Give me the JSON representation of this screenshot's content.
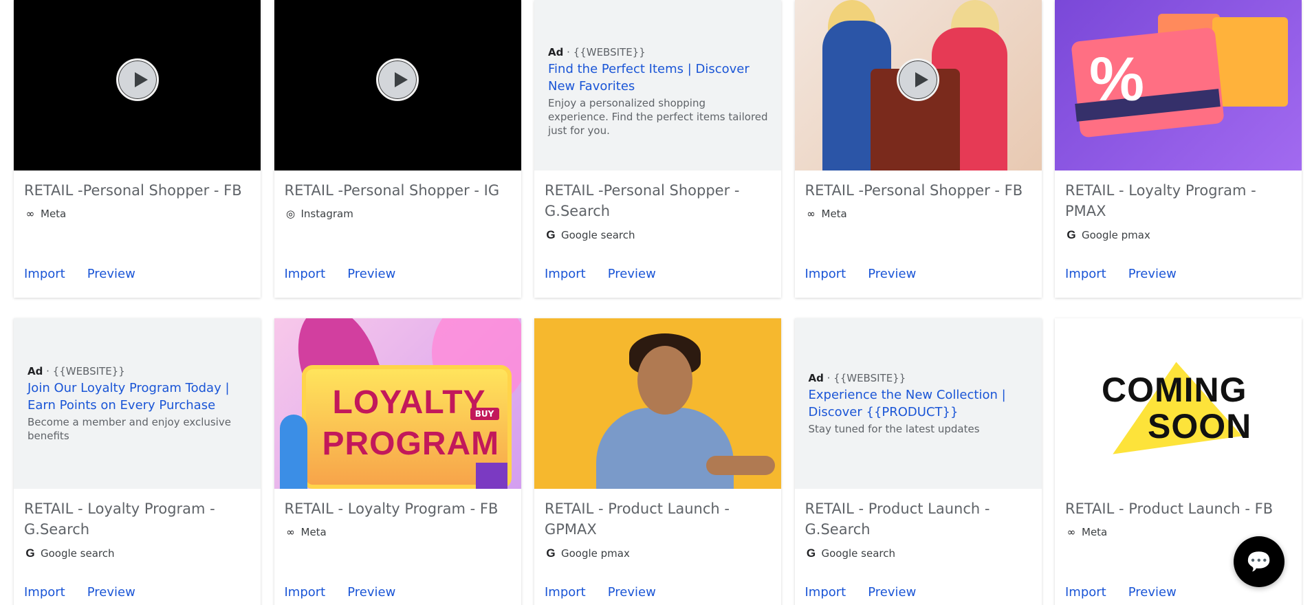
{
  "cards": [
    {
      "title": "RETAIL -Personal Shopper - FB",
      "platform": "Meta",
      "platform_icon": "meta-icon",
      "import": "Import",
      "preview": "Preview"
    },
    {
      "title": "RETAIL -Personal Shopper - IG",
      "platform": "Instagram",
      "platform_icon": "instagram-icon",
      "import": "Import",
      "preview": "Preview"
    },
    {
      "title": "RETAIL -Personal Shopper - G.Search",
      "platform": "Google search",
      "platform_icon": "google-icon",
      "import": "Import",
      "preview": "Preview",
      "ad": {
        "label": "Ad",
        "site": " · {{WEBSITE}}",
        "headline": "Find the Perfect Items | Discover New Favorites",
        "desc": "Enjoy a personalized shopping experience. Find the perfect items tailored just for you."
      }
    },
    {
      "title": "RETAIL -Personal Shopper - FB",
      "platform": "Meta",
      "platform_icon": "meta-icon",
      "import": "Import",
      "preview": "Preview"
    },
    {
      "title": "RETAIL - Loyalty Program - PMAX",
      "platform": "Google pmax",
      "platform_icon": "google-icon",
      "import": "Import",
      "preview": "Preview"
    },
    {
      "title": "RETAIL - Loyalty Program - G.Search",
      "platform": "Google search",
      "platform_icon": "google-icon",
      "import": "Import",
      "preview": "Preview",
      "ad": {
        "label": "Ad",
        "site": " · {{WEBSITE}}",
        "headline": "Join Our Loyalty Program Today | Earn Points on Every Purchase",
        "desc": "Become a member and enjoy exclusive benefits"
      }
    },
    {
      "title": "RETAIL - Loyalty Program - FB",
      "platform": "Meta",
      "platform_icon": "meta-icon",
      "import": "Import",
      "preview": "Preview",
      "image_text": {
        "line1": "LOYALTY",
        "line2": "PROGRAM",
        "badge": "BUY"
      }
    },
    {
      "title": "RETAIL - Product Launch - GPMAX",
      "platform": "Google pmax",
      "platform_icon": "google-icon",
      "import": "Import",
      "preview": "Preview"
    },
    {
      "title": "RETAIL - Product Launch - G.Search",
      "platform": "Google search",
      "platform_icon": "google-icon",
      "import": "Import",
      "preview": "Preview",
      "ad": {
        "label": "Ad",
        "site": " · {{WEBSITE}}",
        "headline": "Experience the New Collection | Discover {{PRODUCT}}",
        "desc": "Stay tuned for the latest updates"
      }
    },
    {
      "title": "RETAIL - Product Launch - FB",
      "platform": "Meta",
      "platform_icon": "meta-icon",
      "import": "Import",
      "preview": "Preview",
      "image_text": {
        "line1": "COMING",
        "line2": "SOON"
      }
    }
  ],
  "colors": {
    "link": "#1a55d6",
    "title": "#5f6368",
    "ad_bg": "#f1f3f4"
  },
  "chat_icon": "chat-icon"
}
